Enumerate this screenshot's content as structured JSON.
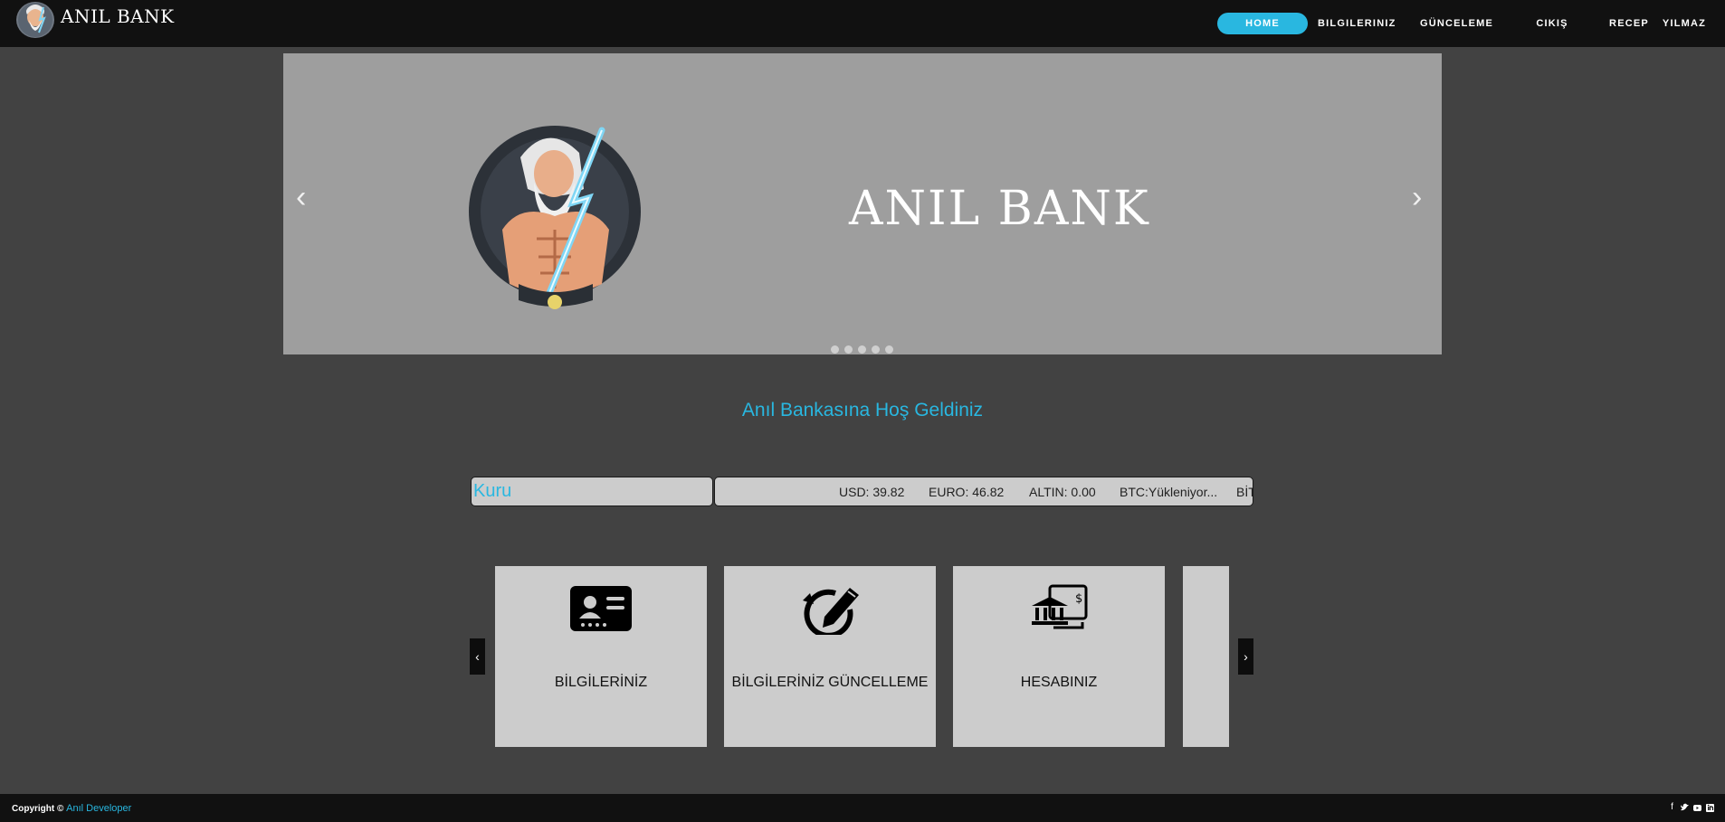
{
  "brand": {
    "name": "ANIL BANK"
  },
  "nav": {
    "home": "HOME",
    "bilgileriniz": "BILGILERINIZ",
    "guncelleme": "GÜNCELEME",
    "cikis": "CIKIŞ",
    "user_first": "RECEP",
    "user_last": "YILMAZ"
  },
  "hero": {
    "title": "ANIL BANK",
    "prev": "‹",
    "next": "›",
    "slide_count": 5
  },
  "welcome": "Anıl Bankasına Hoş Geldiniz",
  "ticker": {
    "label": "Kuru",
    "items": [
      "USD: 39.82",
      "EURO: 46.82",
      "ALTIN: 0.00",
      "BTC:Yükleniyor...",
      "BİT"
    ]
  },
  "cards": {
    "prev": "‹",
    "next": "›",
    "items": [
      {
        "label": "BİLGİLERİNİZ",
        "icon": "id-card-icon"
      },
      {
        "label": "BİLGİLERİNİZ GÜNCELLEME",
        "icon": "edit-pencil-icon"
      },
      {
        "label": "HESABINIZ",
        "icon": "bank-account-icon"
      }
    ]
  },
  "footer": {
    "copyright": "Copyright ©",
    "developer": "Anıl Developer",
    "social": [
      "facebook-icon",
      "twitter-icon",
      "youtube-icon",
      "linkedin-icon"
    ]
  },
  "colors": {
    "accent": "#29b7e0",
    "navbar": "#111111",
    "background": "#424242",
    "hero": "#9e9e9e",
    "card": "#cccccc"
  }
}
